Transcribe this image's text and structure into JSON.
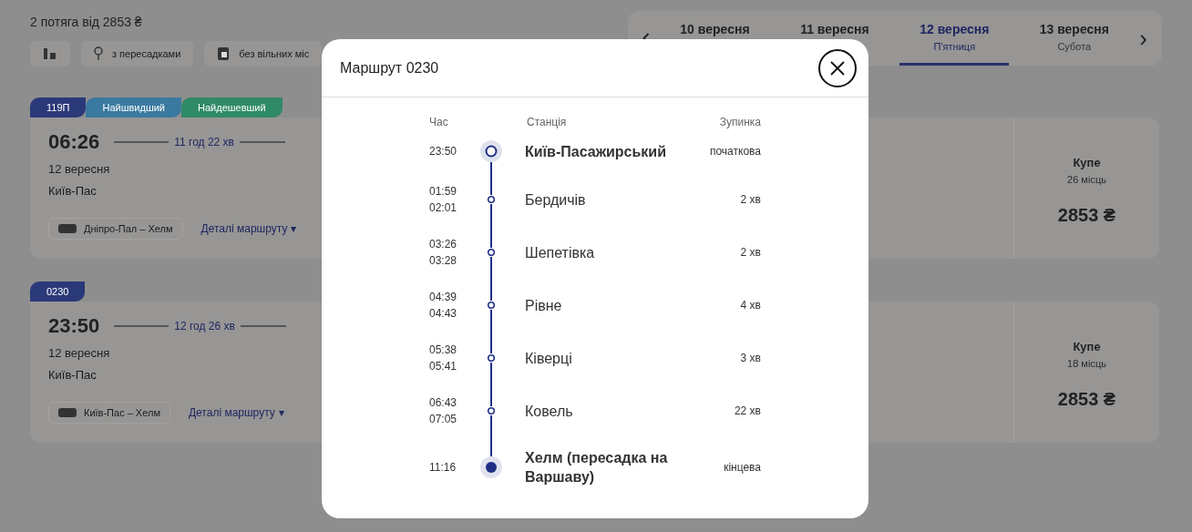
{
  "page": {
    "summary": "2 потяга від 2853 ₴",
    "filters": [
      {
        "kind": "sort"
      },
      {
        "kind": "transfer",
        "label": "з пересадками"
      },
      {
        "kind": "seats",
        "label": "без вільних міс"
      }
    ],
    "next": "›",
    "dates": [
      {
        "date": "10 вересня",
        "selected": false
      },
      {
        "date": "11 вересня",
        "selected": false
      },
      {
        "date": "12 вересня",
        "weekday": "П'ятниця",
        "selected": true
      },
      {
        "date": "13 вересня",
        "weekday": "Субота",
        "selected": false
      }
    ],
    "trains": [
      {
        "tags": [
          {
            "label": "119П",
            "color": "#2a3a78"
          },
          {
            "label": "Найшвидший",
            "color": "#3a7aa0"
          },
          {
            "label": "Найдешевший",
            "color": "#2f8a68"
          }
        ],
        "departure": "06:26",
        "duration": "11 год 22 хв",
        "date": "12 вересня",
        "station": "Київ-Пас",
        "route": "Дніпро-Пал – Хелм",
        "details": "Деталі маршруту",
        "caret": "▾",
        "class": "Купе",
        "seats": "26 місць",
        "price": "2853 ₴"
      },
      {
        "tags": [
          {
            "label": "0230",
            "color": "#2a3a78"
          }
        ],
        "departure": "23:50",
        "duration": "12 год 26 хв",
        "date": "12 вересня",
        "station": "Київ-Пас",
        "route": "Київ-Пас – Хелм",
        "details": "Деталі маршруту",
        "caret": "▾",
        "class": "Купе",
        "seats": "18 місць",
        "price": "2853 ₴"
      }
    ]
  },
  "dialog": {
    "title": "Маршрут 0230",
    "columns": [
      "Час",
      "Станція",
      "Зупинка"
    ],
    "stops": [
      {
        "kind": "start",
        "times": [
          "23:50"
        ],
        "station": "Київ-Пасажирський",
        "stop": "початкова"
      },
      {
        "kind": "middle",
        "times": [
          "01:59",
          "02:01"
        ],
        "station": "Бердичів",
        "stop": "2 хв"
      },
      {
        "kind": "middle",
        "times": [
          "03:26",
          "03:28"
        ],
        "station": "Шепетівка",
        "stop": "2 хв"
      },
      {
        "kind": "middle",
        "times": [
          "04:39",
          "04:43"
        ],
        "station": "Рівне",
        "stop": "4 хв"
      },
      {
        "kind": "middle",
        "times": [
          "05:38",
          "05:41"
        ],
        "station": "Ківерці",
        "stop": "3 хв"
      },
      {
        "kind": "middle",
        "times": [
          "06:43",
          "07:05"
        ],
        "station": "Ковель",
        "stop": "22 хв"
      },
      {
        "kind": "end",
        "times": [
          "11:16"
        ],
        "station": "Хелм (пересадка на Варшаву)",
        "stop": "кінцева"
      }
    ]
  }
}
